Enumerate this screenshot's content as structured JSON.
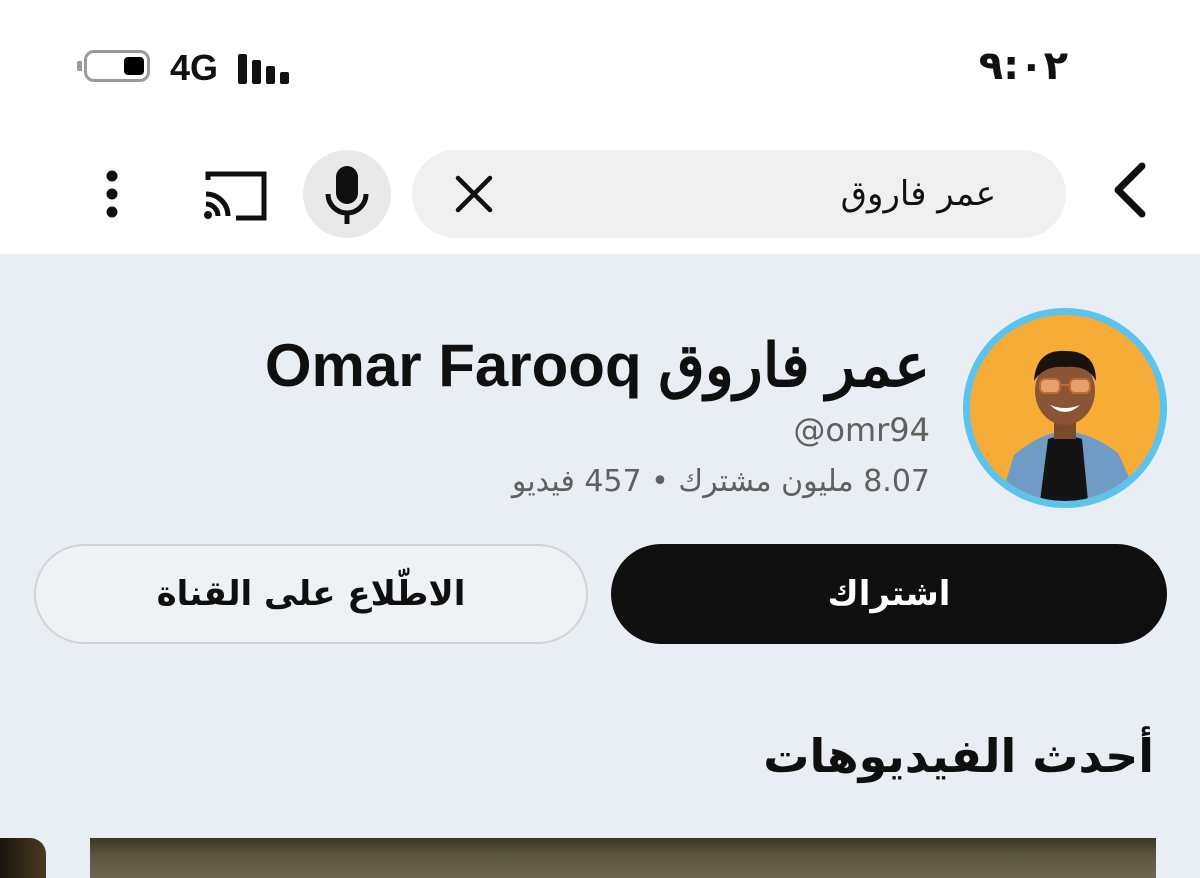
{
  "status_bar": {
    "time": "٩:٠٢",
    "network": "4G"
  },
  "search": {
    "query": "عمر فاروق"
  },
  "channel": {
    "name": "Omar Farooq عمر فاروق",
    "handle": "@omr94",
    "stats": "8.07 مليون مشترك • 457 فيديو",
    "subscribe_label": "اشتراك",
    "view_channel_label": "الاطّلاع على القناة",
    "avatar_bg": "#f5ad38",
    "ring_color": "#5cc3ee"
  },
  "latest_videos": {
    "title": "أحدث الفيديوهات"
  },
  "colors": {
    "page_bg": "#e8eef3",
    "primary_button": "#0f0f0f",
    "secondary_text": "#606060"
  }
}
